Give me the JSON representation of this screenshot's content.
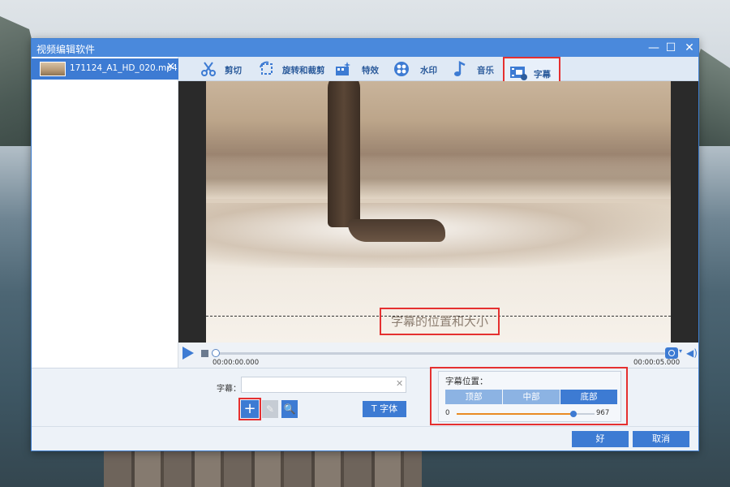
{
  "window": {
    "title": "视频编辑软件",
    "minimize_glyph": "—",
    "maximize_glyph": "☐",
    "close_glyph": "✕"
  },
  "file_panel": {
    "items": [
      {
        "name": "171124_A1_HD_020.mp4",
        "close_glyph": "✕",
        "selected": true
      }
    ]
  },
  "toolbar": {
    "tools": [
      {
        "label": "剪切",
        "icon": "scissors-icon"
      },
      {
        "label": "旋转和裁剪",
        "icon": "rotate-crop-icon"
      },
      {
        "label": "特效",
        "icon": "effects-icon"
      },
      {
        "label": "水印",
        "icon": "watermark-icon"
      },
      {
        "label": "音乐",
        "icon": "music-note-icon"
      },
      {
        "label": "字幕",
        "icon": "subtitle-icon",
        "active": true
      }
    ]
  },
  "preview": {
    "subtitle_text": "字幕的位置和大小"
  },
  "playback": {
    "time_start": "00:00:00.000",
    "time_end": "00:00:05.000",
    "camera_drop_glyph": "▾",
    "volume_glyph": "◀)"
  },
  "subtitle_editor": {
    "label": "字幕：",
    "input_value": "",
    "input_placeholder": "",
    "clear_glyph": "✕",
    "add_glyph": "+",
    "edit_glyph": "✎",
    "search_glyph": "🔍",
    "font_button": "T 字体"
  },
  "subtitle_position": {
    "title": "字幕位置：",
    "options": [
      "顶部",
      "中部",
      "底部"
    ],
    "selected": "底部",
    "slider_min": "0",
    "slider_max": "967",
    "slider_value": 967
  },
  "footer": {
    "ok_label": "好",
    "cancel_label": "取消"
  },
  "colors": {
    "accent": "#3d7bd3",
    "titlebar": "#4a89dc",
    "highlight_box": "#e53030",
    "slider_fill": "#e98b24"
  }
}
